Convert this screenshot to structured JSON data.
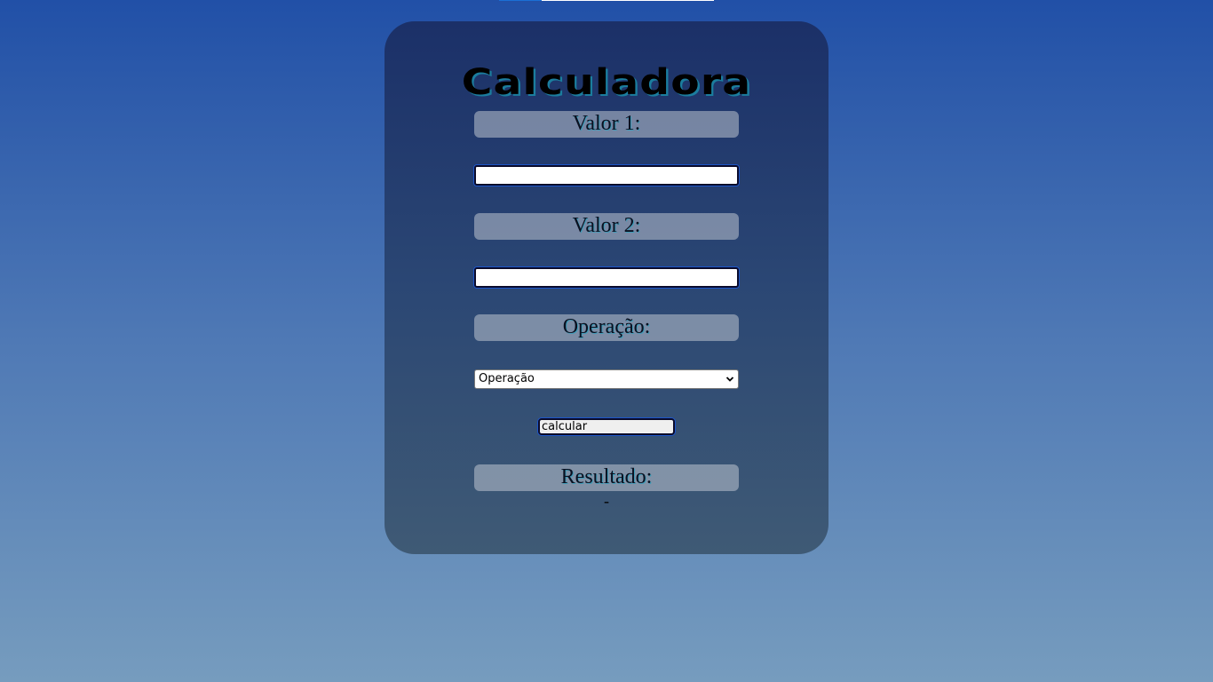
{
  "title": "Calculadora",
  "fields": {
    "valor1_label": "Valor 1:",
    "valor1_value": "",
    "valor2_label": "Valor 2:",
    "valor2_value": "",
    "operacao_label": "Operação:",
    "operacao_selected": "Operação"
  },
  "button_label": "calcular",
  "resultado_label": "Resultado:",
  "resultado_value": "-",
  "colors": {
    "page_top": "#2150a7",
    "page_bottom": "#769cbe",
    "card_top": "#1b3068",
    "card_bottom": "#3f5a75",
    "title_shadow": "#1b7d9e"
  }
}
